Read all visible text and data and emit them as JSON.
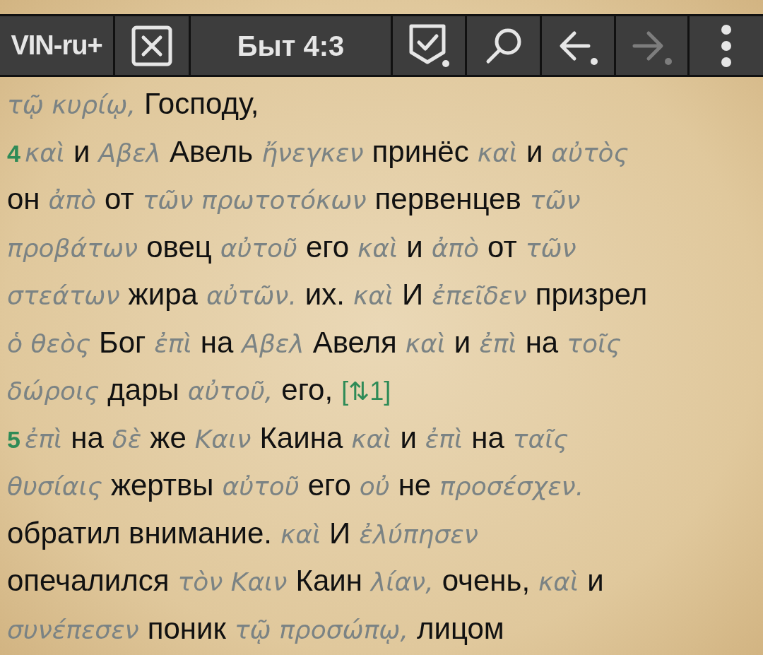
{
  "toolbar": [
    {
      "kind": "label",
      "text": "VIN-ru+",
      "disabled": false
    },
    {
      "kind": "close",
      "disabled": false
    },
    {
      "kind": "title",
      "text": "Быт 4:3",
      "disabled": false
    },
    {
      "kind": "check",
      "disabled": false
    },
    {
      "kind": "search",
      "disabled": false
    },
    {
      "kind": "back",
      "disabled": false
    },
    {
      "kind": "forward",
      "disabled": true
    },
    {
      "kind": "menu",
      "disabled": false
    }
  ],
  "lines": [
    [
      {
        "kind": "greek",
        "text": "τῷ κυρίῳ,"
      },
      {
        "kind": "russian",
        "text": "Господу,"
      }
    ],
    [
      {
        "kind": "verse",
        "text": "4"
      },
      {
        "kind": "greek",
        "text": "καὶ"
      },
      {
        "kind": "russian",
        "text": "и"
      },
      {
        "kind": "greek",
        "text": "Αβελ"
      },
      {
        "kind": "russian",
        "text": "Авель"
      },
      {
        "kind": "greek",
        "text": "ἤνεγκεν"
      },
      {
        "kind": "russian",
        "text": "принёс"
      },
      {
        "kind": "greek",
        "text": "καὶ"
      },
      {
        "kind": "russian",
        "text": "и"
      },
      {
        "kind": "greek",
        "text": "αὐτὸς"
      }
    ],
    [
      {
        "kind": "russian",
        "text": "он"
      },
      {
        "kind": "greek",
        "text": "ἀπὸ"
      },
      {
        "kind": "russian",
        "text": "от"
      },
      {
        "kind": "greek",
        "text": "τῶν πρωτοτόκων"
      },
      {
        "kind": "russian",
        "text": "первенцев"
      },
      {
        "kind": "greek",
        "text": "τῶν"
      }
    ],
    [
      {
        "kind": "greek",
        "text": "προβάτων"
      },
      {
        "kind": "russian",
        "text": "овец"
      },
      {
        "kind": "greek",
        "text": "αὐτοῦ"
      },
      {
        "kind": "russian",
        "text": "его"
      },
      {
        "kind": "greek",
        "text": "καὶ"
      },
      {
        "kind": "russian",
        "text": "и"
      },
      {
        "kind": "greek",
        "text": "ἀπὸ"
      },
      {
        "kind": "russian",
        "text": "от"
      },
      {
        "kind": "greek",
        "text": "τῶν"
      }
    ],
    [
      {
        "kind": "greek",
        "text": "στεάτων"
      },
      {
        "kind": "russian",
        "text": "жира"
      },
      {
        "kind": "greek",
        "text": "αὐτῶν."
      },
      {
        "kind": "russian",
        "text": "их."
      },
      {
        "kind": "greek",
        "text": "καὶ"
      },
      {
        "kind": "russian",
        "text": "И"
      },
      {
        "kind": "greek",
        "text": "ἐπεῖδεν"
      },
      {
        "kind": "russian",
        "text": "призрел"
      }
    ],
    [
      {
        "kind": "greek",
        "text": "ὁ θεὸς"
      },
      {
        "kind": "russian",
        "text": "Бог"
      },
      {
        "kind": "greek",
        "text": "ἐπὶ"
      },
      {
        "kind": "russian",
        "text": "на"
      },
      {
        "kind": "greek",
        "text": "Αβελ"
      },
      {
        "kind": "russian",
        "text": "Авеля"
      },
      {
        "kind": "greek",
        "text": "καὶ"
      },
      {
        "kind": "russian",
        "text": "и"
      },
      {
        "kind": "greek",
        "text": "ἐπὶ"
      },
      {
        "kind": "russian",
        "text": "на"
      },
      {
        "kind": "greek",
        "text": "τοῖς"
      }
    ],
    [
      {
        "kind": "greek",
        "text": "δώροις"
      },
      {
        "kind": "russian",
        "text": "дары"
      },
      {
        "kind": "greek",
        "text": "αὐτοῦ,"
      },
      {
        "kind": "russian",
        "text": "его,"
      },
      {
        "kind": "note",
        "text": "[⇅1]"
      }
    ],
    [
      {
        "kind": "verse",
        "text": "5"
      },
      {
        "kind": "greek",
        "text": "ἐπὶ"
      },
      {
        "kind": "russian",
        "text": "на"
      },
      {
        "kind": "greek",
        "text": "δὲ"
      },
      {
        "kind": "russian",
        "text": "же"
      },
      {
        "kind": "greek",
        "text": "Καιν"
      },
      {
        "kind": "russian",
        "text": "Каина"
      },
      {
        "kind": "greek",
        "text": "καὶ"
      },
      {
        "kind": "russian",
        "text": "и"
      },
      {
        "kind": "greek",
        "text": "ἐπὶ"
      },
      {
        "kind": "russian",
        "text": "на"
      },
      {
        "kind": "greek",
        "text": "ταῖς"
      }
    ],
    [
      {
        "kind": "greek",
        "text": "θυσίαις"
      },
      {
        "kind": "russian",
        "text": "жертвы"
      },
      {
        "kind": "greek",
        "text": "αὐτοῦ"
      },
      {
        "kind": "russian",
        "text": "его"
      },
      {
        "kind": "greek",
        "text": "οὐ"
      },
      {
        "kind": "russian",
        "text": "не"
      },
      {
        "kind": "greek",
        "text": "προσέσχεν."
      }
    ],
    [
      {
        "kind": "russian",
        "text": "обратил внимание."
      },
      {
        "kind": "greek",
        "text": "καὶ"
      },
      {
        "kind": "russian",
        "text": "И"
      },
      {
        "kind": "greek",
        "text": "ἐλύπησεν"
      }
    ],
    [
      {
        "kind": "russian",
        "text": "опечалился"
      },
      {
        "kind": "greek",
        "text": "τὸν Καιν"
      },
      {
        "kind": "russian",
        "text": "Каин"
      },
      {
        "kind": "greek",
        "text": "λίαν,"
      },
      {
        "kind": "russian",
        "text": "очень,"
      },
      {
        "kind": "greek",
        "text": "καὶ"
      },
      {
        "kind": "russian",
        "text": "и"
      }
    ],
    [
      {
        "kind": "greek",
        "text": "συνέπεσεν"
      },
      {
        "kind": "russian",
        "text": "поник"
      },
      {
        "kind": "greek",
        "text": "τῷ προσώπῳ,"
      },
      {
        "kind": "russian",
        "text": "лицом"
      }
    ]
  ]
}
